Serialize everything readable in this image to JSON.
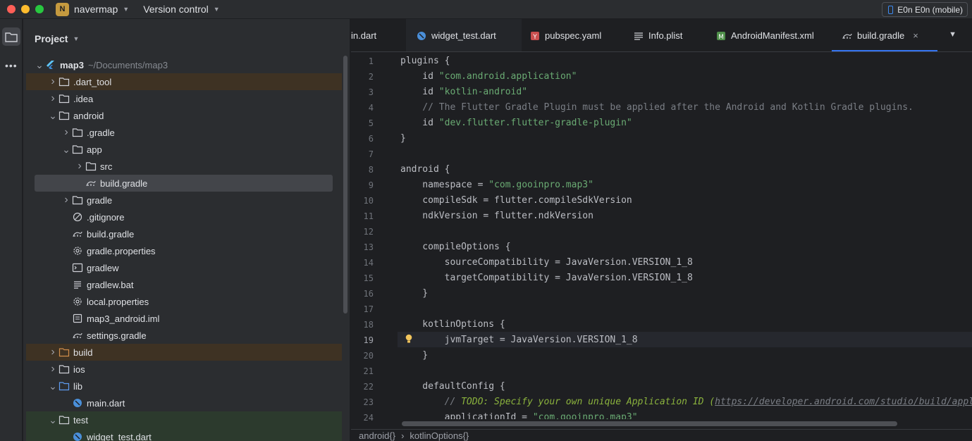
{
  "titlebar": {
    "project_initial": "N",
    "project_name": "navermap",
    "version_control": "Version control",
    "device": "E0n E0n (mobile)"
  },
  "panel": {
    "title": "Project"
  },
  "tree": [
    {
      "label": "map3",
      "hint": "~/Documents/map3",
      "depth": 0,
      "arrow": "open",
      "icon": "flutter-icon",
      "bold": true,
      "style": ""
    },
    {
      "label": ".dart_tool",
      "depth": 1,
      "arrow": "closed",
      "icon": "folder-icon",
      "style": "excluded"
    },
    {
      "label": ".idea",
      "depth": 1,
      "arrow": "closed",
      "icon": "folder-icon",
      "style": ""
    },
    {
      "label": "android",
      "depth": 1,
      "arrow": "open",
      "icon": "folder-icon",
      "style": ""
    },
    {
      "label": ".gradle",
      "depth": 2,
      "arrow": "closed",
      "icon": "folder-icon",
      "style": ""
    },
    {
      "label": "app",
      "depth": 2,
      "arrow": "open",
      "icon": "folder-icon",
      "style": ""
    },
    {
      "label": "src",
      "depth": 3,
      "arrow": "closed",
      "icon": "folder-icon",
      "style": ""
    },
    {
      "label": "build.gradle",
      "depth": 3,
      "arrow": "",
      "icon": "gradle-icon",
      "style": "selected"
    },
    {
      "label": "gradle",
      "depth": 2,
      "arrow": "closed",
      "icon": "folder-icon",
      "style": ""
    },
    {
      "label": ".gitignore",
      "depth": 2,
      "arrow": "",
      "icon": "gitignore-icon",
      "style": ""
    },
    {
      "label": "build.gradle",
      "depth": 2,
      "arrow": "",
      "icon": "gradle-icon",
      "style": ""
    },
    {
      "label": "gradle.properties",
      "depth": 2,
      "arrow": "",
      "icon": "gear-icon",
      "style": ""
    },
    {
      "label": "gradlew",
      "depth": 2,
      "arrow": "",
      "icon": "terminal-icon",
      "style": ""
    },
    {
      "label": "gradlew.bat",
      "depth": 2,
      "arrow": "",
      "icon": "text-file-icon",
      "style": ""
    },
    {
      "label": "local.properties",
      "depth": 2,
      "arrow": "",
      "icon": "gear-icon",
      "style": ""
    },
    {
      "label": "map3_android.iml",
      "depth": 2,
      "arrow": "",
      "icon": "module-file-icon",
      "style": ""
    },
    {
      "label": "settings.gradle",
      "depth": 2,
      "arrow": "",
      "icon": "gradle-icon",
      "style": ""
    },
    {
      "label": "build",
      "depth": 1,
      "arrow": "closed",
      "icon": "folder-orange-icon",
      "style": "excluded"
    },
    {
      "label": "ios",
      "depth": 1,
      "arrow": "closed",
      "icon": "folder-icon",
      "style": ""
    },
    {
      "label": "lib",
      "depth": 1,
      "arrow": "open",
      "icon": "folder-blue-icon",
      "style": ""
    },
    {
      "label": "main.dart",
      "depth": 2,
      "arrow": "",
      "icon": "dart-icon",
      "style": ""
    },
    {
      "label": "test",
      "depth": 1,
      "arrow": "open",
      "icon": "folder-icon",
      "style": "testrow"
    },
    {
      "label": "widget_test.dart",
      "depth": 2,
      "arrow": "",
      "icon": "dart-icon",
      "style": "testrow"
    }
  ],
  "tabs": [
    {
      "label": "in.dart",
      "icon": "",
      "left": 0
    },
    {
      "label": "widget_test.dart",
      "icon": "dart-icon"
    },
    {
      "label": "pubspec.yaml",
      "icon": "yaml-icon"
    },
    {
      "label": "Info.plist",
      "icon": "list-icon"
    },
    {
      "label": "AndroidManifest.xml",
      "icon": "manifest-icon"
    },
    {
      "label": "build.gradle",
      "icon": "gradle-icon",
      "active": true
    }
  ],
  "code": [
    [
      [
        "plugins {",
        ""
      ]
    ],
    [
      [
        "    id ",
        ""
      ],
      [
        "\"com.android.application\"",
        "str"
      ]
    ],
    [
      [
        "    id ",
        ""
      ],
      [
        "\"kotlin-android\"",
        "str"
      ]
    ],
    [
      [
        "    // The Flutter Gradle Plugin must be applied after the Android and Kotlin Gradle plugins.",
        "cmt"
      ]
    ],
    [
      [
        "    id ",
        ""
      ],
      [
        "\"dev.flutter.flutter-gradle-plugin\"",
        "str"
      ]
    ],
    [
      [
        "}",
        ""
      ]
    ],
    [
      [
        "",
        ""
      ]
    ],
    [
      [
        "android {",
        ""
      ]
    ],
    [
      [
        "    namespace = ",
        ""
      ],
      [
        "\"com.gooinpro.map3\"",
        "str"
      ]
    ],
    [
      [
        "    compileSdk = flutter.compileSdkVersion",
        ""
      ]
    ],
    [
      [
        "    ndkVersion = flutter.ndkVersion",
        ""
      ]
    ],
    [
      [
        "",
        ""
      ]
    ],
    [
      [
        "    compileOptions {",
        ""
      ]
    ],
    [
      [
        "        sourceCompatibility = JavaVersion.VERSION_1_8",
        ""
      ]
    ],
    [
      [
        "        targetCompatibility = JavaVersion.VERSION_1_8",
        ""
      ]
    ],
    [
      [
        "    }",
        ""
      ]
    ],
    [
      [
        "",
        ""
      ]
    ],
    [
      [
        "    kotlinOptions {",
        ""
      ]
    ],
    [
      [
        "        jvmTarget = JavaVersion.VERSION_1_8",
        ""
      ]
    ],
    [
      [
        "    }",
        ""
      ]
    ],
    [
      [
        "",
        ""
      ]
    ],
    [
      [
        "    defaultConfig {",
        ""
      ]
    ],
    [
      [
        "        // ",
        "cmti"
      ],
      [
        "TODO: Specify your own unique Application ID (",
        "todo"
      ],
      [
        "https://developer.android.com/studio/build/application-id.html",
        "link"
      ],
      [
        ").",
        "todo"
      ]
    ],
    [
      [
        "        applicationId = ",
        ""
      ],
      [
        "\"com.gooinpro.map3\"",
        "str"
      ]
    ]
  ],
  "line_numbers": [
    "1",
    "2",
    "3",
    "4",
    "5",
    "6",
    "7",
    "8",
    "9",
    "10",
    "11",
    "12",
    "13",
    "14",
    "15",
    "16",
    "17",
    "18",
    "19",
    "20",
    "21",
    "22",
    "23",
    "24"
  ],
  "current_line": "19",
  "breadcrumb": [
    "android{}",
    "kotlinOptions{}"
  ]
}
